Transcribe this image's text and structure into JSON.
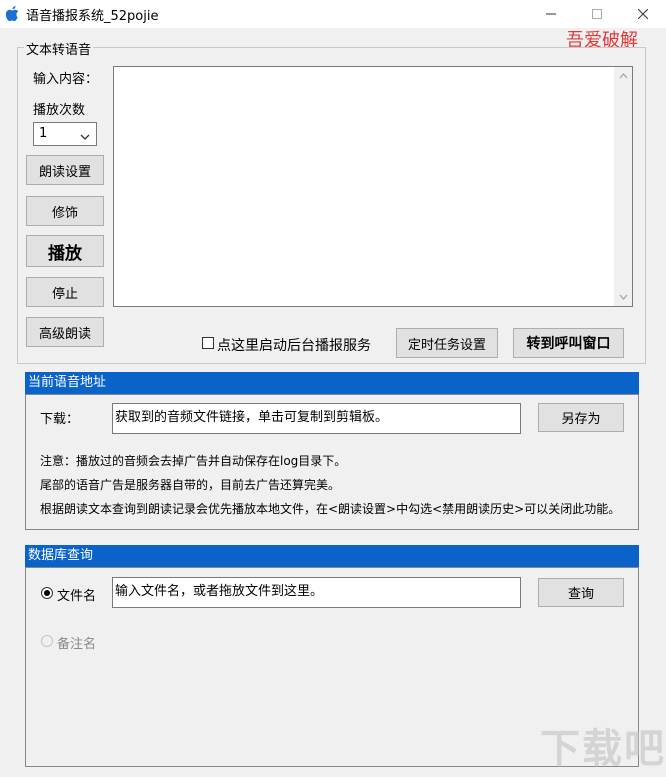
{
  "window": {
    "title": "语音播报系统_52pojie",
    "watermark": "吾爱破解"
  },
  "tts_group": {
    "legend": "文本转语音",
    "input_label": "输入内容：",
    "play_count_label": "播放次数",
    "play_count_value": "1",
    "buttons": {
      "read_settings": "朗读设置",
      "decorate": "修饰",
      "play": "播放",
      "stop": "停止",
      "advanced_read": "高级朗读"
    },
    "text_content": "",
    "background_service_label": "点这里启动后台播报服务",
    "timer_button": "定时任务设置",
    "call_window_button": "转到呼叫窗口"
  },
  "voice_address": {
    "header": "当前语音地址",
    "download_label": "下载：",
    "download_value": "获取到的音频文件链接，单击可复制到剪辑板。",
    "save_as_button": "另存为",
    "notes": [
      "注意：播放过的音频会去掉广告并自动保存在log目录下。",
      "尾部的语音广告是服务器自带的，目前去广告还算完美。",
      "根据朗读文本查询到朗读记录会优先播放本地文件，在<朗读设置>中勾选<禁用朗读历史>可以关闭此功能。"
    ]
  },
  "db_query": {
    "header": "数据库查询",
    "filename_label": "文件名",
    "filename_placeholder": "输入文件名，或者拖放文件到这里。",
    "remark_label": "备注名",
    "query_button": "查询"
  },
  "corner_watermark": "下载吧"
}
